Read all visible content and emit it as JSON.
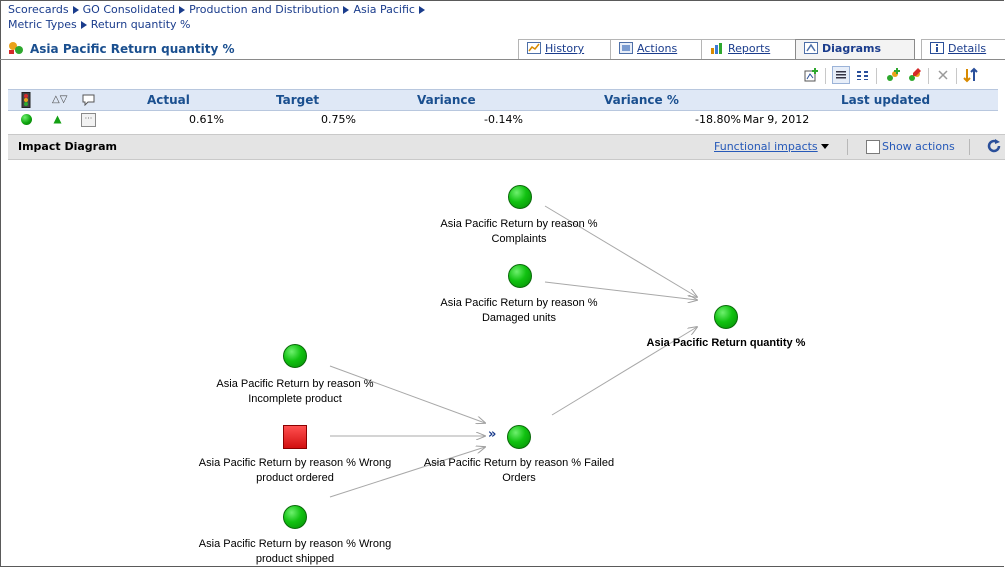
{
  "breadcrumb": {
    "items": [
      "Scorecards",
      "GO Consolidated",
      "Production and Distribution",
      "Asia Pacific"
    ],
    "second_line_items": [
      "Metric Types",
      "Return quantity %"
    ]
  },
  "page_title": "Asia Pacific Return quantity %",
  "tabs": [
    {
      "label": "History",
      "icon": "history-chart-icon",
      "active": false
    },
    {
      "label": "Actions",
      "icon": "actions-icon",
      "active": false
    },
    {
      "label": "Reports",
      "icon": "reports-bar-icon",
      "active": false
    },
    {
      "label": "Diagrams",
      "icon": "diagram-icon",
      "active": true
    },
    {
      "label": "Details",
      "icon": "info-icon",
      "active": false
    }
  ],
  "toolbar_icons": [
    "add-diagram-icon",
    "list-view-icon",
    "grid-view-icon",
    "add-metric-icon",
    "edit-metric-icon",
    "delete-icon",
    "sort-icon"
  ],
  "metric_grid": {
    "columns": [
      "Actual",
      "Target",
      "Variance",
      "Variance %",
      "Last updated"
    ],
    "row": {
      "actual": "0.61%",
      "target": "0.75%",
      "variance": "-0.14%",
      "variance_pct": "-18.80%",
      "last_updated": "Mar 9, 2012",
      "status": "green",
      "trend": "up"
    }
  },
  "impact_panel": {
    "title": "Impact Diagram",
    "filter_label": "Functional impacts",
    "show_actions_label": "Show actions",
    "show_actions_checked": false
  },
  "diagram": {
    "nodes": [
      {
        "id": "complaints",
        "label": "Asia Pacific Return by reason %\nComplaints",
        "status": "green"
      },
      {
        "id": "damaged",
        "label": "Asia Pacific Return by reason %\nDamaged units",
        "status": "green"
      },
      {
        "id": "target",
        "label": "Asia Pacific Return quantity %",
        "status": "green",
        "bold": true
      },
      {
        "id": "incomplete",
        "label": "Asia Pacific Return by reason %\nIncomplete product",
        "status": "green"
      },
      {
        "id": "wrong_ordered",
        "label": "Asia Pacific Return by reason % Wrong\nproduct ordered",
        "status": "red"
      },
      {
        "id": "failed_orders",
        "label": "Asia Pacific Return by reason % Failed\nOrders",
        "status": "green"
      },
      {
        "id": "wrong_shipped",
        "label": "Asia Pacific Return by reason % Wrong\nproduct shipped",
        "status": "green"
      }
    ],
    "expand_marker": "»"
  }
}
